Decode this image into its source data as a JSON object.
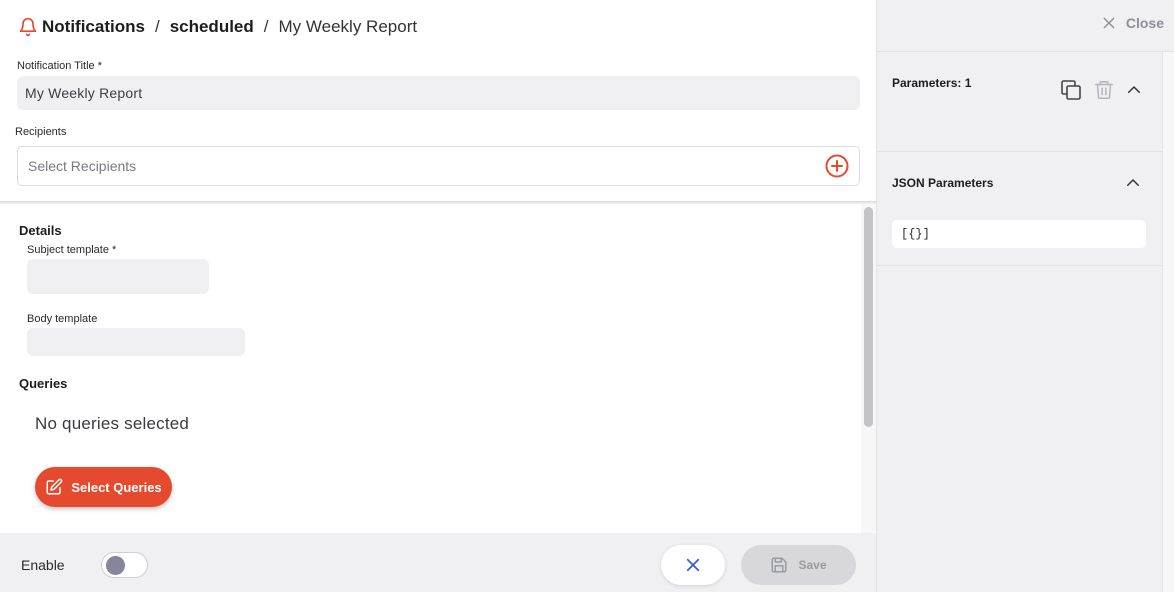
{
  "breadcrumb": {
    "root": "Notifications",
    "folder": "scheduled",
    "current": "My Weekly Report",
    "separator": "/"
  },
  "form": {
    "title_label": "Notification Title *",
    "title_value": "My Weekly Report",
    "recipients_label": "Recipients",
    "recipients_placeholder": "Select Recipients"
  },
  "details": {
    "heading": "Details",
    "subject_label": "Subject template *",
    "body_label": "Body template"
  },
  "queries": {
    "heading": "Queries",
    "empty_text": "No queries selected",
    "select_button": "Select Queries"
  },
  "footer": {
    "enable_label": "Enable",
    "enabled": false,
    "save_label": "Save"
  },
  "side_panel": {
    "close_label": "Close",
    "params_title": "Parameters: 1",
    "json_title": "JSON Parameters",
    "json_value": "[{}]"
  },
  "colors": {
    "accent": "#e64a2e",
    "cancel_icon": "#3b5bdb",
    "panel_bg": "#f0f0f2"
  }
}
